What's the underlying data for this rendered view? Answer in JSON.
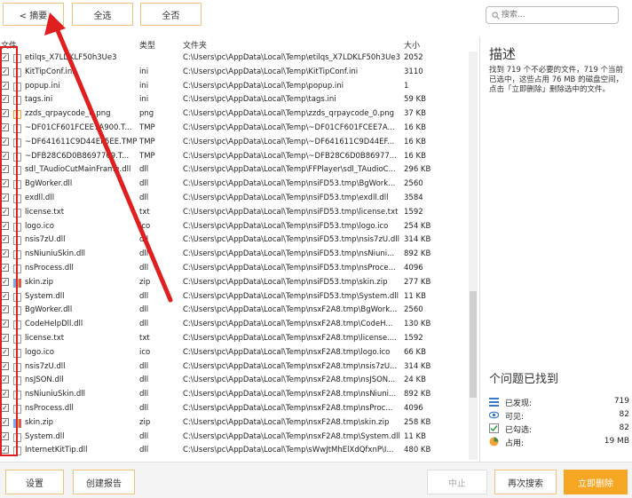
{
  "toolbar": {
    "summary_label": "< 摘要",
    "select_all_label": "全选",
    "select_none_label": "全否"
  },
  "search": {
    "placeholder": "搜索..."
  },
  "table": {
    "headers": {
      "file": "文件",
      "type": "类型",
      "folder": "文件夹",
      "size": "大小"
    },
    "rows": [
      {
        "name": "etilqs_X7LDKLF50h3Ue3",
        "type": "",
        "path": "C:\\Users\\pc\\AppData\\Local\\Temp\\etilqs_X7LDKLF50h3Ue3",
        "size": "2052",
        "icon": "file"
      },
      {
        "name": "KitTipConf.ini",
        "type": "ini",
        "path": "C:\\Users\\pc\\AppData\\Local\\Temp\\KitTipConf.ini",
        "size": "3110",
        "icon": "file"
      },
      {
        "name": "popup.ini",
        "type": "ini",
        "path": "C:\\Users\\pc\\AppData\\Local\\Temp\\popup.ini",
        "size": "1",
        "icon": "file"
      },
      {
        "name": "tags.ini",
        "type": "ini",
        "path": "C:\\Users\\pc\\AppData\\Local\\Temp\\tags.ini",
        "size": "59 KB",
        "icon": "file"
      },
      {
        "name": "zzds_qrpaycode_0.png",
        "type": "png",
        "path": "C:\\Users\\pc\\AppData\\Local\\Temp\\zzds_qrpaycode_0.png",
        "size": "37 KB",
        "icon": "png"
      },
      {
        "name": "~DF01CF601FCEE7A900.T...",
        "type": "TMP",
        "path": "C:\\Users\\pc\\AppData\\Local\\Temp\\~DF01CF601FCEE7A...",
        "size": "16 KB",
        "icon": "file"
      },
      {
        "name": "~DF641611C9D44EF5EE.TMP",
        "type": "TMP",
        "path": "C:\\Users\\pc\\AppData\\Local\\Temp\\~DF641611C9D44EF...",
        "size": "16 KB",
        "icon": "file"
      },
      {
        "name": "~DFB28C6D0B8697709.T...",
        "type": "TMP",
        "path": "C:\\Users\\pc\\AppData\\Local\\Temp\\~DFB28C6D0B86977...",
        "size": "16 KB",
        "icon": "file"
      },
      {
        "name": "sdl_TAudioCutMainFrame.dll",
        "type": "dll",
        "path": "C:\\Users\\pc\\AppData\\Local\\Temp\\FFPlayer\\sdl_TAudioC...",
        "size": "296 KB",
        "icon": "file"
      },
      {
        "name": "BgWorker.dll",
        "type": "dll",
        "path": "C:\\Users\\pc\\AppData\\Local\\Temp\\nsiFD53.tmp\\BgWork...",
        "size": "2560",
        "icon": "file"
      },
      {
        "name": "exdll.dll",
        "type": "dll",
        "path": "C:\\Users\\pc\\AppData\\Local\\Temp\\nsiFD53.tmp\\exdll.dll",
        "size": "3584",
        "icon": "file"
      },
      {
        "name": "license.txt",
        "type": "txt",
        "path": "C:\\Users\\pc\\AppData\\Local\\Temp\\nsiFD53.tmp\\license.txt",
        "size": "1592",
        "icon": "file"
      },
      {
        "name": "logo.ico",
        "type": "ico",
        "path": "C:\\Users\\pc\\AppData\\Local\\Temp\\nsiFD53.tmp\\logo.ico",
        "size": "254 KB",
        "icon": "file"
      },
      {
        "name": "nsis7zU.dll",
        "type": "dll",
        "path": "C:\\Users\\pc\\AppData\\Local\\Temp\\nsiFD53.tmp\\nsis7zU.dll",
        "size": "314 KB",
        "icon": "file"
      },
      {
        "name": "nsNiuniuSkin.dll",
        "type": "dll",
        "path": "C:\\Users\\pc\\AppData\\Local\\Temp\\nsiFD53.tmp\\nsNiuni...",
        "size": "892 KB",
        "icon": "file"
      },
      {
        "name": "nsProcess.dll",
        "type": "dll",
        "path": "C:\\Users\\pc\\AppData\\Local\\Temp\\nsiFD53.tmp\\nsProce...",
        "size": "4096",
        "icon": "file"
      },
      {
        "name": "skin.zip",
        "type": "zip",
        "path": "C:\\Users\\pc\\AppData\\Local\\Temp\\nsiFD53.tmp\\skin.zip",
        "size": "277 KB",
        "icon": "zip"
      },
      {
        "name": "System.dll",
        "type": "dll",
        "path": "C:\\Users\\pc\\AppData\\Local\\Temp\\nsiFD53.tmp\\System.dll",
        "size": "11 KB",
        "icon": "file"
      },
      {
        "name": "BgWorker.dll",
        "type": "dll",
        "path": "C:\\Users\\pc\\AppData\\Local\\Temp\\nsxF2A8.tmp\\BgWork...",
        "size": "2560",
        "icon": "file"
      },
      {
        "name": "CodeHelpDll.dll",
        "type": "dll",
        "path": "C:\\Users\\pc\\AppData\\Local\\Temp\\nsxF2A8.tmp\\CodeH...",
        "size": "130 KB",
        "icon": "file"
      },
      {
        "name": "license.txt",
        "type": "txt",
        "path": "C:\\Users\\pc\\AppData\\Local\\Temp\\nsxF2A8.tmp\\license....",
        "size": "1592",
        "icon": "file"
      },
      {
        "name": "logo.ico",
        "type": "ico",
        "path": "C:\\Users\\pc\\AppData\\Local\\Temp\\nsxF2A8.tmp\\logo.ico",
        "size": "66 KB",
        "icon": "file"
      },
      {
        "name": "nsis7zU.dll",
        "type": "dll",
        "path": "C:\\Users\\pc\\AppData\\Local\\Temp\\nsxF2A8.tmp\\nsis7zU...",
        "size": "314 KB",
        "icon": "file"
      },
      {
        "name": "nsJSON.dll",
        "type": "dll",
        "path": "C:\\Users\\pc\\AppData\\Local\\Temp\\nsxF2A8.tmp\\nsJSON...",
        "size": "24 KB",
        "icon": "file"
      },
      {
        "name": "nsNiuniuSkin.dll",
        "type": "dll",
        "path": "C:\\Users\\pc\\AppData\\Local\\Temp\\nsxF2A8.tmp\\nsNiuni...",
        "size": "892 KB",
        "icon": "file"
      },
      {
        "name": "nsProcess.dll",
        "type": "dll",
        "path": "C:\\Users\\pc\\AppData\\Local\\Temp\\nsxF2A8.tmp\\nsProc...",
        "size": "4096",
        "icon": "file"
      },
      {
        "name": "skin.zip",
        "type": "zip",
        "path": "C:\\Users\\pc\\AppData\\Local\\Temp\\nsxF2A8.tmp\\skin.zip",
        "size": "258 KB",
        "icon": "zip"
      },
      {
        "name": "System.dll",
        "type": "dll",
        "path": "C:\\Users\\pc\\AppData\\Local\\Temp\\nsxF2A8.tmp\\System.dll",
        "size": "11 KB",
        "icon": "file"
      },
      {
        "name": "InternetKitTip.dll",
        "type": "dll",
        "path": "C:\\Users\\pc\\AppData\\Local\\Temp\\sWwJtMhElXdQfxnP\\I...",
        "size": "480 KB",
        "icon": "file"
      }
    ]
  },
  "panel": {
    "desc_title": "描述",
    "desc_text": "找到 719 个不必要的文件，719 个当前已选中，这些占用 76 MB 的磁盘空间，点击「立即删除」删除选中的文件。",
    "issues_title": "个问题已找到",
    "stats": [
      {
        "label": "已发现:",
        "value": "719",
        "icon": "list-icon"
      },
      {
        "label": "可见:",
        "value": "82",
        "icon": "eye-icon"
      },
      {
        "label": "已勾选:",
        "value": "82",
        "icon": "checkbox-icon"
      },
      {
        "label": "占用:",
        "value": "19 MB",
        "icon": "pie-chart-icon"
      }
    ]
  },
  "footer": {
    "settings_label": "设置",
    "report_label": "创建报告",
    "stop_label": "中止",
    "rescan_label": "再次搜索",
    "delete_label": "立即删除"
  },
  "colors": {
    "accent": "#f2c27a",
    "delete_button": "#f5a623",
    "annotation": "#e02020"
  }
}
